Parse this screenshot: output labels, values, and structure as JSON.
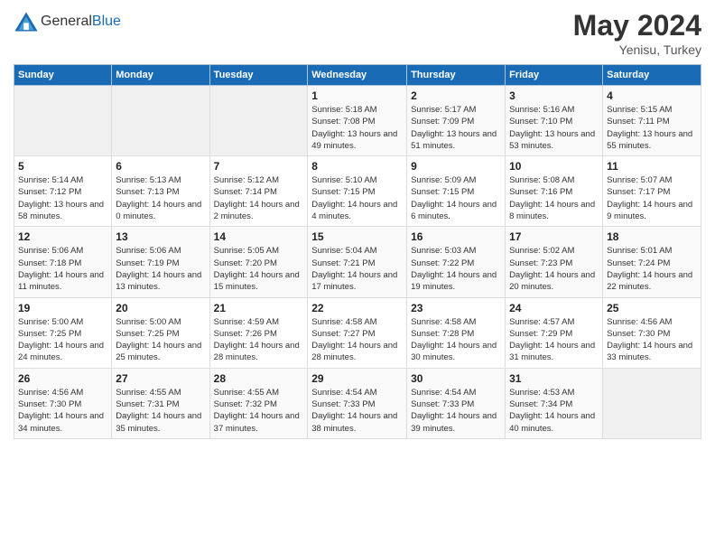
{
  "header": {
    "logo_general": "General",
    "logo_blue": "Blue",
    "month": "May 2024",
    "location": "Yenisu, Turkey"
  },
  "days_of_week": [
    "Sunday",
    "Monday",
    "Tuesday",
    "Wednesday",
    "Thursday",
    "Friday",
    "Saturday"
  ],
  "weeks": [
    [
      {
        "day": "",
        "info": ""
      },
      {
        "day": "",
        "info": ""
      },
      {
        "day": "",
        "info": ""
      },
      {
        "day": "1",
        "info": "Sunrise: 5:18 AM\nSunset: 7:08 PM\nDaylight: 13 hours and 49 minutes."
      },
      {
        "day": "2",
        "info": "Sunrise: 5:17 AM\nSunset: 7:09 PM\nDaylight: 13 hours and 51 minutes."
      },
      {
        "day": "3",
        "info": "Sunrise: 5:16 AM\nSunset: 7:10 PM\nDaylight: 13 hours and 53 minutes."
      },
      {
        "day": "4",
        "info": "Sunrise: 5:15 AM\nSunset: 7:11 PM\nDaylight: 13 hours and 55 minutes."
      }
    ],
    [
      {
        "day": "5",
        "info": "Sunrise: 5:14 AM\nSunset: 7:12 PM\nDaylight: 13 hours and 58 minutes."
      },
      {
        "day": "6",
        "info": "Sunrise: 5:13 AM\nSunset: 7:13 PM\nDaylight: 14 hours and 0 minutes."
      },
      {
        "day": "7",
        "info": "Sunrise: 5:12 AM\nSunset: 7:14 PM\nDaylight: 14 hours and 2 minutes."
      },
      {
        "day": "8",
        "info": "Sunrise: 5:10 AM\nSunset: 7:15 PM\nDaylight: 14 hours and 4 minutes."
      },
      {
        "day": "9",
        "info": "Sunrise: 5:09 AM\nSunset: 7:15 PM\nDaylight: 14 hours and 6 minutes."
      },
      {
        "day": "10",
        "info": "Sunrise: 5:08 AM\nSunset: 7:16 PM\nDaylight: 14 hours and 8 minutes."
      },
      {
        "day": "11",
        "info": "Sunrise: 5:07 AM\nSunset: 7:17 PM\nDaylight: 14 hours and 9 minutes."
      }
    ],
    [
      {
        "day": "12",
        "info": "Sunrise: 5:06 AM\nSunset: 7:18 PM\nDaylight: 14 hours and 11 minutes."
      },
      {
        "day": "13",
        "info": "Sunrise: 5:06 AM\nSunset: 7:19 PM\nDaylight: 14 hours and 13 minutes."
      },
      {
        "day": "14",
        "info": "Sunrise: 5:05 AM\nSunset: 7:20 PM\nDaylight: 14 hours and 15 minutes."
      },
      {
        "day": "15",
        "info": "Sunrise: 5:04 AM\nSunset: 7:21 PM\nDaylight: 14 hours and 17 minutes."
      },
      {
        "day": "16",
        "info": "Sunrise: 5:03 AM\nSunset: 7:22 PM\nDaylight: 14 hours and 19 minutes."
      },
      {
        "day": "17",
        "info": "Sunrise: 5:02 AM\nSunset: 7:23 PM\nDaylight: 14 hours and 20 minutes."
      },
      {
        "day": "18",
        "info": "Sunrise: 5:01 AM\nSunset: 7:24 PM\nDaylight: 14 hours and 22 minutes."
      }
    ],
    [
      {
        "day": "19",
        "info": "Sunrise: 5:00 AM\nSunset: 7:25 PM\nDaylight: 14 hours and 24 minutes."
      },
      {
        "day": "20",
        "info": "Sunrise: 5:00 AM\nSunset: 7:25 PM\nDaylight: 14 hours and 25 minutes."
      },
      {
        "day": "21",
        "info": "Sunrise: 4:59 AM\nSunset: 7:26 PM\nDaylight: 14 hours and 28 minutes."
      },
      {
        "day": "22",
        "info": "Sunrise: 4:58 AM\nSunset: 7:27 PM\nDaylight: 14 hours and 28 minutes."
      },
      {
        "day": "23",
        "info": "Sunrise: 4:58 AM\nSunset: 7:28 PM\nDaylight: 14 hours and 30 minutes."
      },
      {
        "day": "24",
        "info": "Sunrise: 4:57 AM\nSunset: 7:29 PM\nDaylight: 14 hours and 31 minutes."
      },
      {
        "day": "25",
        "info": "Sunrise: 4:56 AM\nSunset: 7:30 PM\nDaylight: 14 hours and 33 minutes."
      }
    ],
    [
      {
        "day": "26",
        "info": "Sunrise: 4:56 AM\nSunset: 7:30 PM\nDaylight: 14 hours and 34 minutes."
      },
      {
        "day": "27",
        "info": "Sunrise: 4:55 AM\nSunset: 7:31 PM\nDaylight: 14 hours and 35 minutes."
      },
      {
        "day": "28",
        "info": "Sunrise: 4:55 AM\nSunset: 7:32 PM\nDaylight: 14 hours and 37 minutes."
      },
      {
        "day": "29",
        "info": "Sunrise: 4:54 AM\nSunset: 7:33 PM\nDaylight: 14 hours and 38 minutes."
      },
      {
        "day": "30",
        "info": "Sunrise: 4:54 AM\nSunset: 7:33 PM\nDaylight: 14 hours and 39 minutes."
      },
      {
        "day": "31",
        "info": "Sunrise: 4:53 AM\nSunset: 7:34 PM\nDaylight: 14 hours and 40 minutes."
      },
      {
        "day": "",
        "info": ""
      }
    ]
  ]
}
